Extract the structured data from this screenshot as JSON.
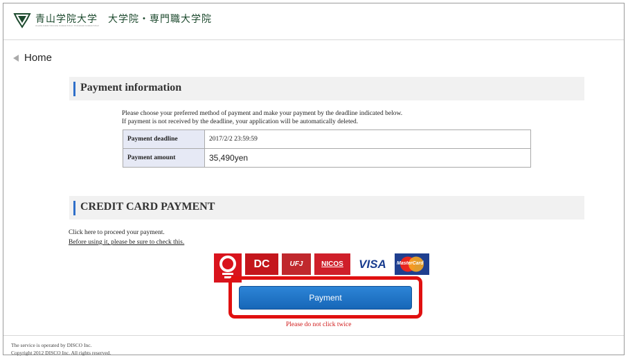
{
  "header": {
    "university_name": "青山学院大学　大学院・専門職大学院",
    "subtitle": "Aoyama Gakuin University Graduate School / Professional Graduate School"
  },
  "nav": {
    "home_label": "Home"
  },
  "payment_info": {
    "title": "Payment information",
    "notice_line1": "Please choose your preferred method of payment and make your payment by the deadline indicated below.",
    "notice_line2": "If payment is not received by the deadline, your application will be automatically deleted.",
    "rows": [
      {
        "label": "Payment deadline",
        "value": "2017/2/2 23:59:59"
      },
      {
        "label": "Payment amount",
        "value": "35,490yen"
      }
    ]
  },
  "credit_card": {
    "title": "CREDIT CARD PAYMENT",
    "proceed_text": "Click here to proceed your payment.",
    "check_link": "Before using it, please be sure to check this.",
    "cards": {
      "ufj": "UFJ",
      "dc": "DC",
      "nicos": "NICOS",
      "visa": "VISA",
      "mastercard": "MasterCard"
    },
    "pay_button": "Payment",
    "warning": "Please do not click twice"
  },
  "footer": {
    "line1": "The service is operated by DISCO Inc.",
    "line2": "Copyright 2012 DISCO Inc. All rights reserved."
  },
  "colors": {
    "accent_blue": "#2f6fc9",
    "highlight_red": "#e01010",
    "button_blue": "#1767b8"
  }
}
